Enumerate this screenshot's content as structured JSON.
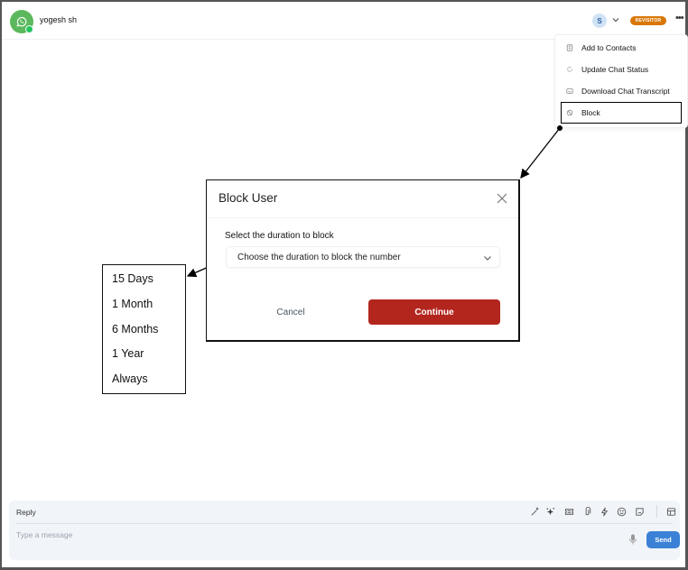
{
  "header": {
    "contact_name": "yogesh sh",
    "channel_icon": "whatsapp-icon",
    "agent_initial": "S",
    "badge": "REVISITOR",
    "more_label": "•••",
    "colors": {
      "channel": "#5cb85c",
      "online": "#22c55e",
      "badge": "#d97706"
    }
  },
  "menu": {
    "items": [
      {
        "label": "Add to Contacts",
        "icon": "contact-card-icon"
      },
      {
        "label": "Update Chat Status",
        "icon": "refresh-icon"
      },
      {
        "label": "Download Chat Transcript",
        "icon": "transcript-icon"
      },
      {
        "label": "Block",
        "icon": "block-icon"
      }
    ],
    "highlighted": "Block"
  },
  "modal": {
    "title": "Block User",
    "field_label": "Select the duration to block",
    "select_placeholder": "Choose the duration to block the number",
    "cancel_label": "Cancel",
    "continue_label": "Continue",
    "continue_color": "#b3261e"
  },
  "duration_options": [
    "15 Days",
    "1 Month",
    "6 Months",
    "1 Year",
    "Always"
  ],
  "composer": {
    "reply_label": "Reply",
    "placeholder": "Type a message",
    "value": "",
    "tools": [
      "magic-wand-icon",
      "sparkle-icon",
      "ticket-icon",
      "attachment-icon",
      "lightning-icon",
      "emoji-icon",
      "sticker-icon",
      "template-icon"
    ],
    "send_label": "Send",
    "send_color": "#3b82d6"
  }
}
